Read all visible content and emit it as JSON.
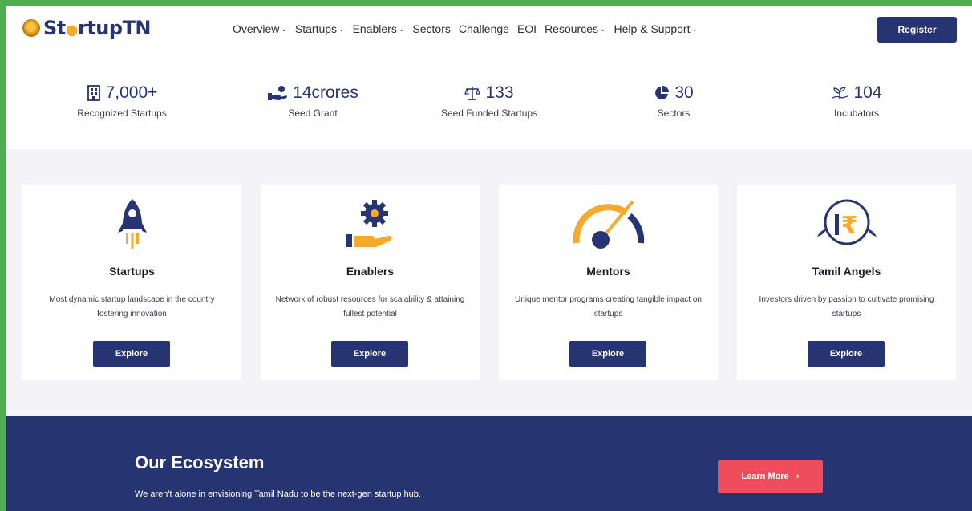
{
  "logo": {
    "text_a": "St",
    "text_b": "rtup",
    "text_c": "TN"
  },
  "nav": {
    "items": [
      {
        "label": "Overview",
        "dropdown": true
      },
      {
        "label": "Startups",
        "dropdown": true
      },
      {
        "label": "Enablers",
        "dropdown": true
      },
      {
        "label": "Sectors",
        "dropdown": false
      },
      {
        "label": "Challenge",
        "dropdown": false
      },
      {
        "label": "EOI",
        "dropdown": false
      },
      {
        "label": "Resources",
        "dropdown": true
      },
      {
        "label": "Help & Support",
        "dropdown": true
      }
    ],
    "register_label": "Register"
  },
  "stats": [
    {
      "value": "7,000+",
      "label": "Recognized Startups",
      "icon": "building-icon"
    },
    {
      "value": "14crores",
      "label": "Seed Grant",
      "icon": "grant-hand-icon"
    },
    {
      "value": "133",
      "label": "Seed Funded Startups",
      "icon": "scales-icon"
    },
    {
      "value": "30",
      "label": "Sectors",
      "icon": "pie-icon"
    },
    {
      "value": "104",
      "label": "Incubators",
      "icon": "incubator-plant-icon"
    }
  ],
  "cards": [
    {
      "title": "Startups",
      "desc": "Most dynamic startup landscape in the country fostering innovation",
      "button": "Explore",
      "icon": "rocket-icon"
    },
    {
      "title": "Enablers",
      "desc": "Network of robust resources for scalability & attaining fullest potential",
      "button": "Explore",
      "icon": "gear-hand-icon"
    },
    {
      "title": "Mentors",
      "desc": "Unique mentor programs creating tangible impact on startups",
      "button": "Explore",
      "icon": "gauge-icon"
    },
    {
      "title": "Tamil Angels",
      "desc": "Investors driven by passion to cultivate promising startups",
      "button": "Explore",
      "icon": "rupee-angel-icon"
    }
  ],
  "ecosystem": {
    "heading": "Our Ecosystem",
    "subtitle": "We aren't alone in envisioning Tamil Nadu to be the next-gen startup hub.",
    "button": "Learn More"
  },
  "colors": {
    "brand": "#273474",
    "accent": "#f6a92b",
    "cta": "#ef4d5c",
    "frame": "#4cae4c"
  }
}
